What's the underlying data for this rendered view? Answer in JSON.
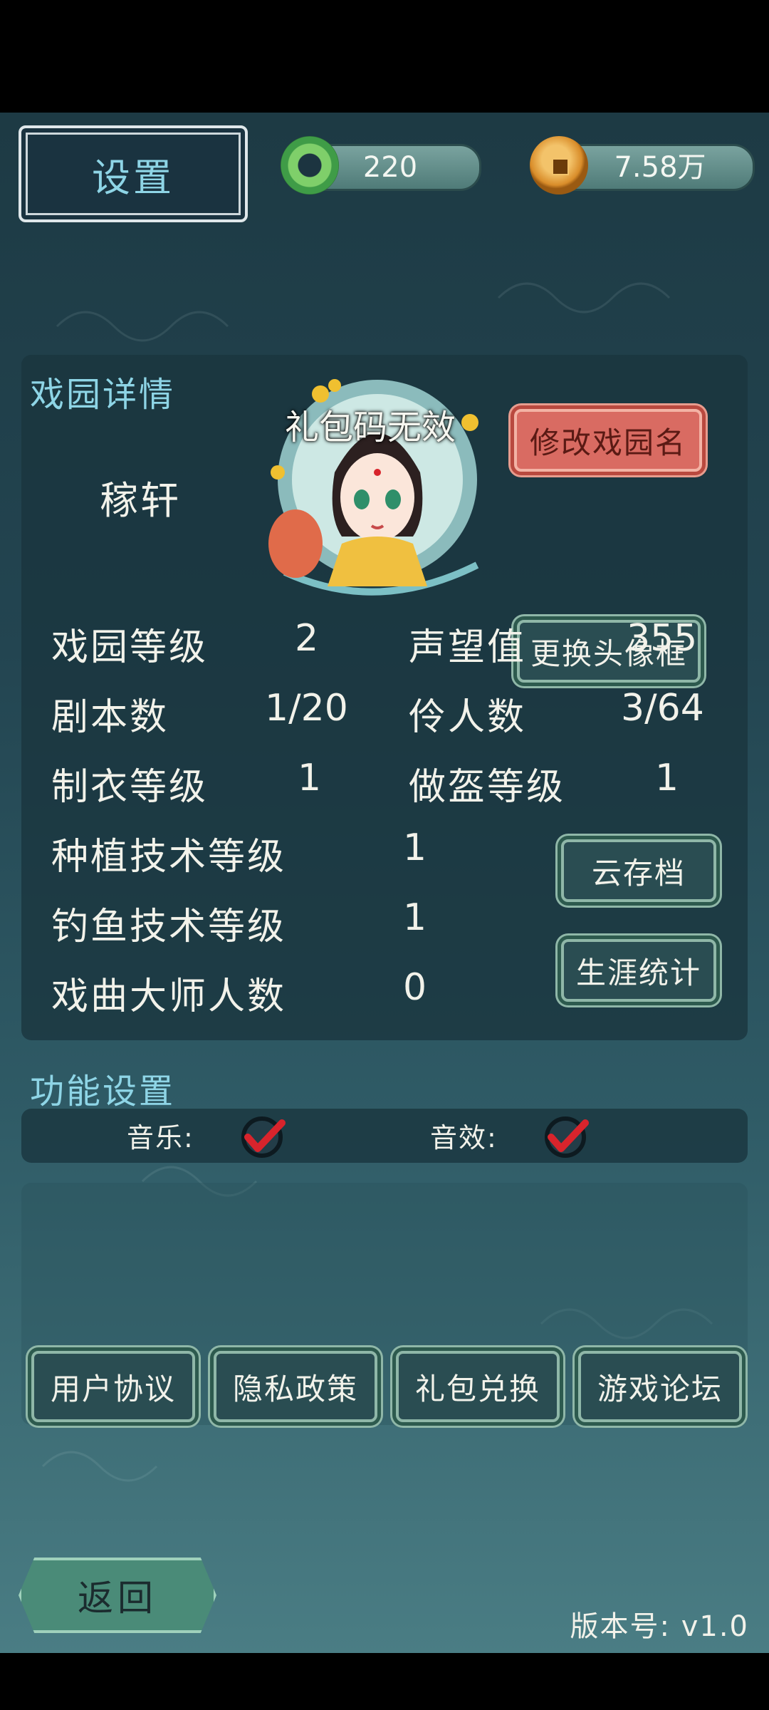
{
  "header": {
    "title": "设置",
    "jade_count": "220",
    "coin_count": "7.58万"
  },
  "garden": {
    "section_title": "戏园详情",
    "name": "稼轩",
    "toast": "礼包码无效",
    "rename_button": "修改戏园名",
    "frame_button": "更换头像框",
    "stats": [
      {
        "label": "戏园等级",
        "value": "2"
      },
      {
        "label": "声望值",
        "value": "355"
      },
      {
        "label": "剧本数",
        "value": "1/20"
      },
      {
        "label": "伶人数",
        "value": "3/64"
      },
      {
        "label": "制衣等级",
        "value": "1"
      },
      {
        "label": "做盔等级",
        "value": "1"
      },
      {
        "label": "种植技术等级",
        "value": "1"
      },
      {
        "label": "钓鱼技术等级",
        "value": "1"
      },
      {
        "label": "戏曲大师人数",
        "value": "0"
      }
    ],
    "cloud_save_button": "云存档",
    "career_stats_button": "生涯统计"
  },
  "settings": {
    "section_title": "功能设置",
    "music_label": "音乐:",
    "music_on": true,
    "sfx_label": "音效:",
    "sfx_on": true,
    "buttons": [
      "用户协议",
      "隐私政策",
      "礼包兑换",
      "游戏论坛"
    ]
  },
  "footer": {
    "back_label": "返回",
    "version": "版本号: v1.0"
  },
  "colors": {
    "accent_text": "#8ed5e6",
    "check_red": "#d8242c",
    "rename_button_bg": "#d96b62"
  }
}
